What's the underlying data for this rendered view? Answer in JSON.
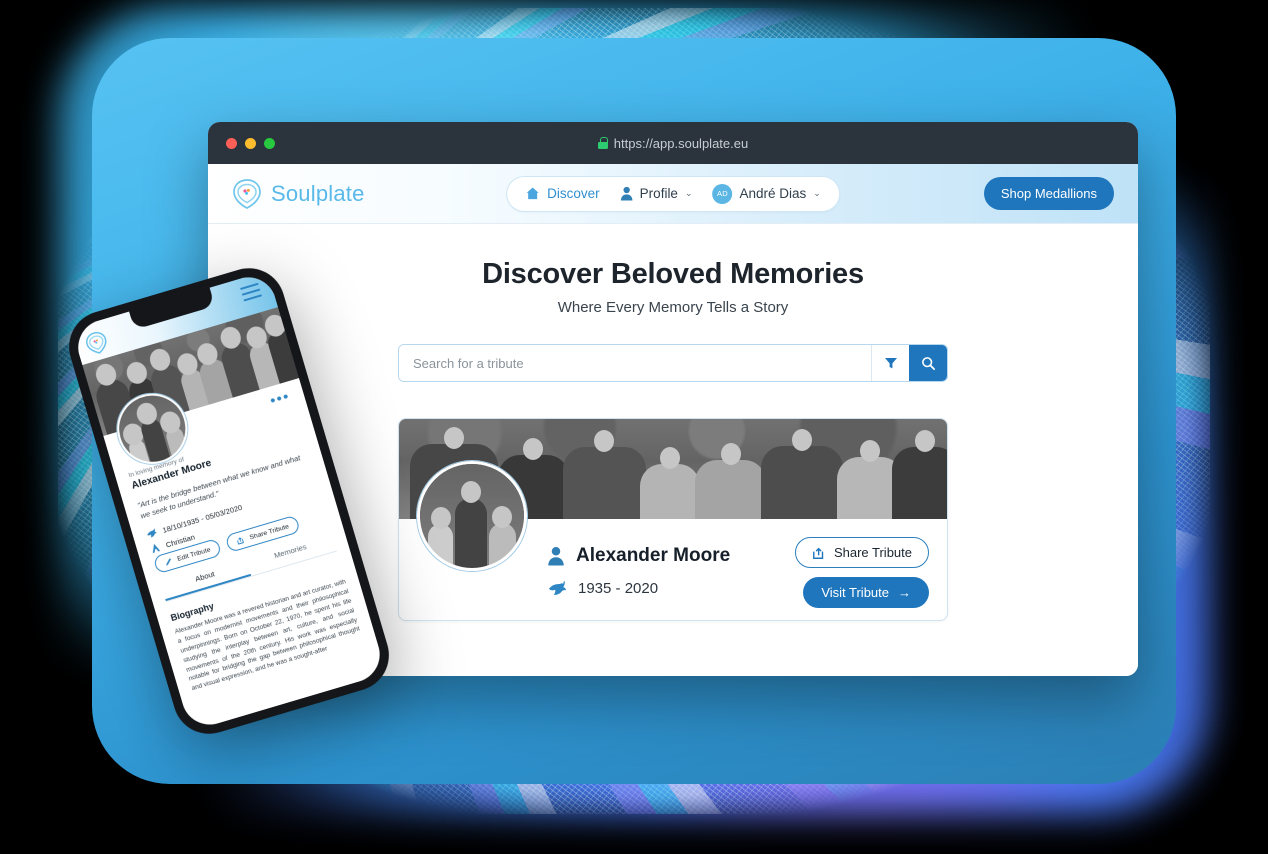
{
  "browser": {
    "url": "https://app.soulplate.eu",
    "lock_icon": "padlock-icon",
    "traffic_lights": [
      "close",
      "minimize",
      "maximize"
    ]
  },
  "nav": {
    "brand": "Soulplate",
    "brand_logo_icon": "heart-pin-logo-icon",
    "items": [
      {
        "label": "Discover",
        "icon": "home-icon",
        "active": true
      },
      {
        "label": "Profile",
        "icon": "person-icon",
        "caret": "⌄"
      },
      {
        "label": "André Dias",
        "icon": "avatar-initials",
        "initials": "AD",
        "caret": "⌄"
      }
    ],
    "shop_button": "Shop Medallions"
  },
  "main": {
    "title": "Discover Beloved Memories",
    "subtitle": "Where Every Memory Tells a Story",
    "search": {
      "placeholder": "Search for a tribute",
      "value": "",
      "filter_icon": "funnel-icon",
      "search_icon": "magnifier-icon"
    },
    "tribute_card": {
      "banner_image": "vintage-family-group-photo",
      "avatar_image": "vintage-man-with-children-photo",
      "name": "Alexander Moore",
      "name_icon": "person-icon",
      "dates": "1935 - 2020",
      "dates_icon": "dove-icon",
      "share_button": "Share Tribute",
      "share_icon": "share-icon",
      "visit_button": "Visit Tribute",
      "visit_arrow": "→"
    }
  },
  "phone": {
    "logo_icon": "heart-pin-logo-icon",
    "menu_icon": "hamburger-icon",
    "more_icon": "more-dots-icon",
    "memory_label": "In loving memory of",
    "name": "Alexander Moore",
    "quote": "\"Art is the bridge between what we know and what we seek to understand.\"",
    "dates": "18/10/1935 - 05/03/2020",
    "dates_icon": "dove-icon",
    "religion": "Christian",
    "religion_icon": "faith-icon",
    "buttons": [
      {
        "label": "Edit Tribute",
        "icon": "pencil-icon"
      },
      {
        "label": "Share Tribute",
        "icon": "share-icon"
      }
    ],
    "tabs": [
      {
        "label": "About",
        "active": true
      },
      {
        "label": "Memories",
        "active": false
      }
    ],
    "bio_heading": "Biography",
    "bio_text": "Alexander Moore was a revered historian and art curator, with a focus on modernist movements and their philosophical underpinnings. Born on October 22, 1970, he spent his life studying the interplay between art, culture, and social movements of the 20th century. His work was especially notable for bridging the gap between philosophical thought and visual expression, and he was a sought-after"
  },
  "colors": {
    "accent_blue": "#1f76bd",
    "brand_blue": "#59b9e8",
    "backdrop_blue": "#3fb2ea",
    "titlebar": "#2b333c"
  }
}
